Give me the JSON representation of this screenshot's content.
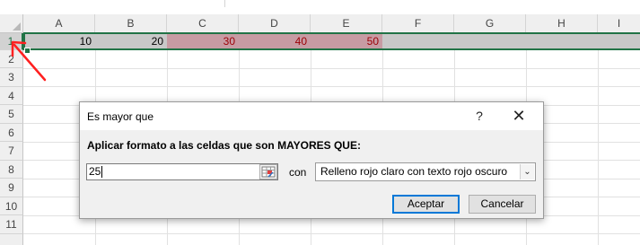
{
  "columns": [
    "A",
    "B",
    "C",
    "D",
    "E",
    "F",
    "G",
    "H",
    "I"
  ],
  "rows": [
    "1",
    "2",
    "3",
    "4",
    "5",
    "6",
    "7",
    "8",
    "9",
    "10",
    "11"
  ],
  "row1_cells": [
    "10",
    "20",
    "30",
    "40",
    "50"
  ],
  "highlight_fill": "#c79ba3",
  "highlight_text": "#9c0006",
  "selection_color": "#217346",
  "dialog": {
    "title": "Es mayor que",
    "help_glyph": "?",
    "close_glyph": "✕",
    "instruction": "Aplicar formato a las celdas que son MAYORES QUE:",
    "input_value": "25",
    "con_label": "con",
    "format_option": "Relleno rojo claro con texto rojo oscuro",
    "accept_label": "Aceptar",
    "cancel_label": "Cancelar"
  },
  "icons": [
    "range-collapse-icon",
    "dropdown-arrow-icon",
    "close-icon",
    "help-icon",
    "annotation-arrow-icon"
  ]
}
